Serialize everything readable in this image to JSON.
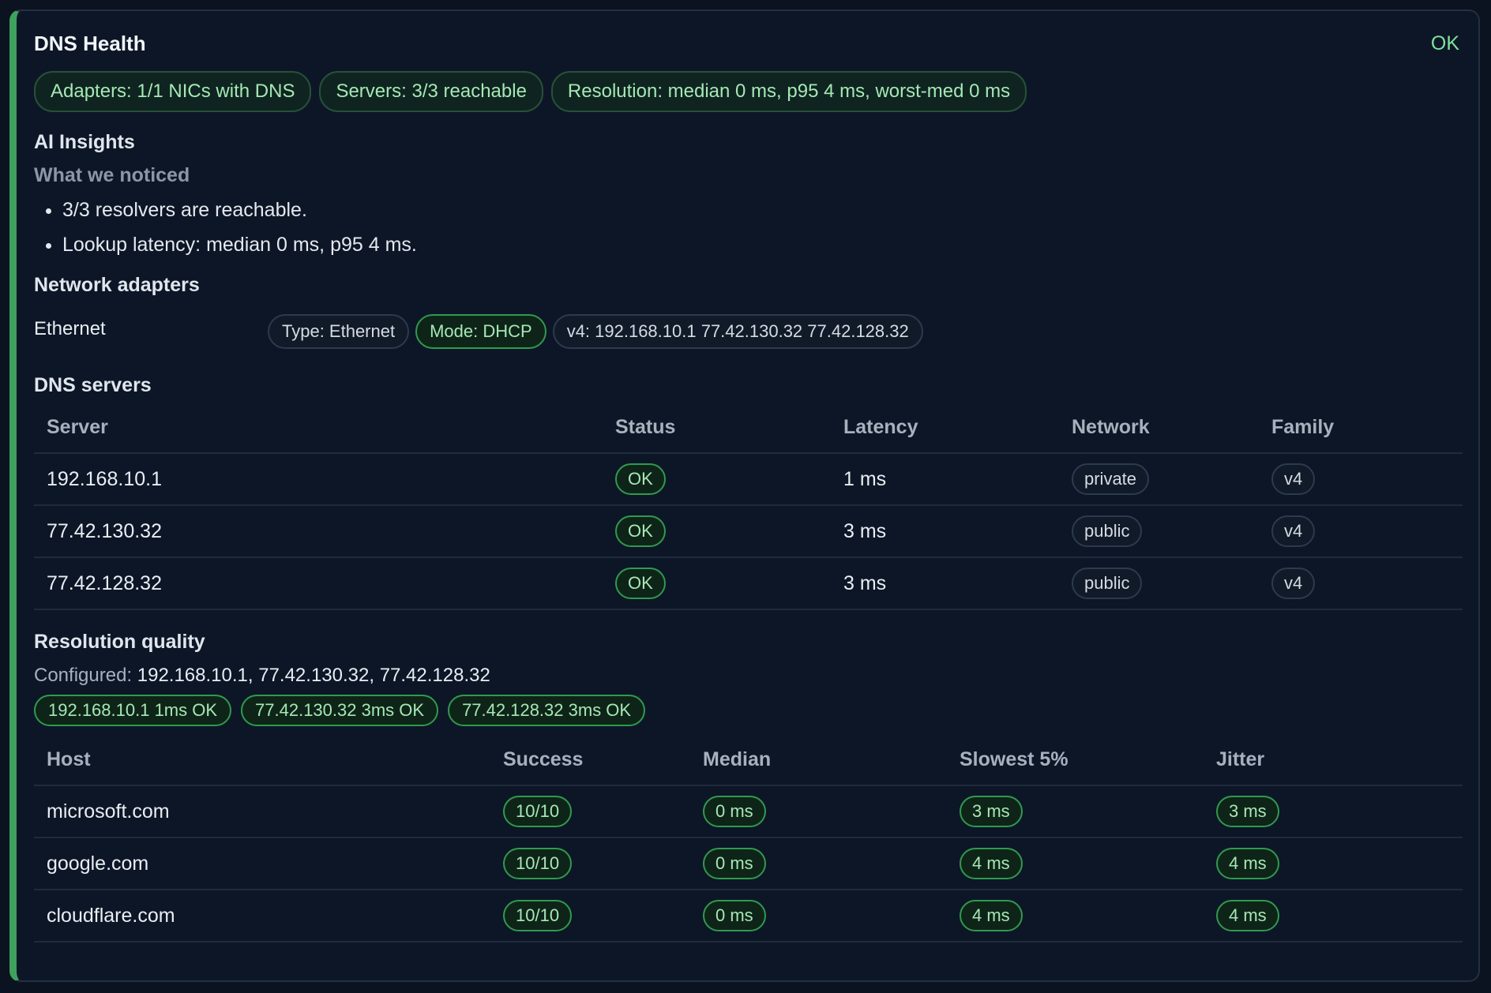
{
  "header": {
    "title": "DNS Health",
    "status": "OK"
  },
  "summary_chips": [
    "Adapters: 1/1 NICs with DNS",
    "Servers: 3/3 reachable",
    "Resolution: median 0 ms, p95 4 ms, worst-med 0 ms"
  ],
  "insights": {
    "title": "AI Insights",
    "subtitle": "What we noticed",
    "items": [
      "3/3 resolvers are reachable.",
      "Lookup latency: median 0 ms, p95 4 ms."
    ]
  },
  "adapters": {
    "title": "Network adapters",
    "rows": [
      {
        "name": "Ethernet",
        "type": "Type: Ethernet",
        "mode": "Mode: DHCP",
        "addresses": "v4: 192.168.10.1 77.42.130.32 77.42.128.32"
      }
    ]
  },
  "dns_servers": {
    "title": "DNS servers",
    "columns": [
      "Server",
      "Status",
      "Latency",
      "Network",
      "Family"
    ],
    "rows": [
      {
        "server": "192.168.10.1",
        "status": "OK",
        "latency": "1 ms",
        "network": "private",
        "family": "v4"
      },
      {
        "server": "77.42.130.32",
        "status": "OK",
        "latency": "3 ms",
        "network": "public",
        "family": "v4"
      },
      {
        "server": "77.42.128.32",
        "status": "OK",
        "latency": "3 ms",
        "network": "public",
        "family": "v4"
      }
    ]
  },
  "resolution": {
    "title": "Resolution quality",
    "configured_label": "Configured:",
    "configured_value": "192.168.10.1, 77.42.130.32, 77.42.128.32",
    "server_chips": [
      "192.168.10.1 1ms OK",
      "77.42.130.32 3ms OK",
      "77.42.128.32 3ms OK"
    ],
    "columns": [
      "Host",
      "Success",
      "Median",
      "Slowest 5%",
      "Jitter"
    ],
    "rows": [
      {
        "host": "microsoft.com",
        "success": "10/10",
        "median": "0 ms",
        "p95": "3 ms",
        "jitter": "3 ms"
      },
      {
        "host": "google.com",
        "success": "10/10",
        "median": "0 ms",
        "p95": "4 ms",
        "jitter": "4 ms"
      },
      {
        "host": "cloudflare.com",
        "success": "10/10",
        "median": "0 ms",
        "p95": "4 ms",
        "jitter": "4 ms"
      }
    ]
  },
  "colors": {
    "accent": "#3fa15e",
    "ok_text": "#7ee2a0",
    "background": "#0b1220"
  }
}
